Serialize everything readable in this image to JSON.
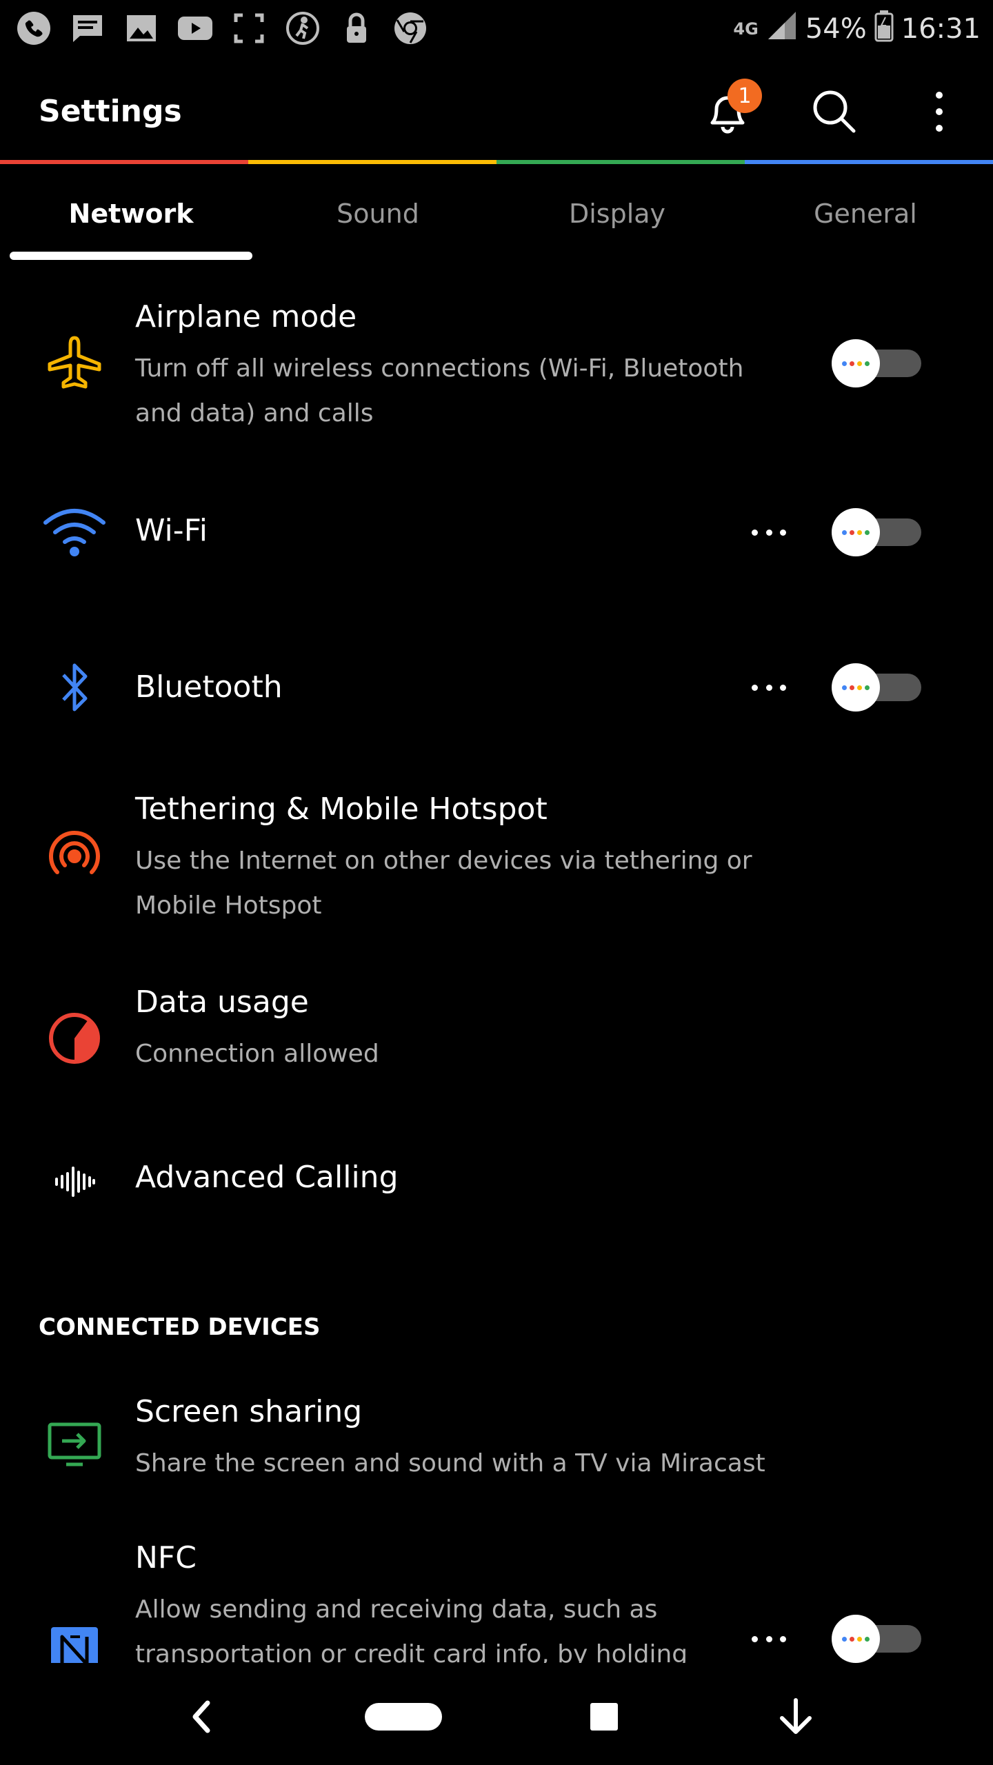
{
  "status_bar": {
    "network": "4G",
    "battery": "54%",
    "time": "16:31",
    "left_icons": [
      "phone-app-icon",
      "message-icon",
      "gallery-icon",
      "youtube-icon",
      "screenshot-icon",
      "fitness-icon",
      "lock-icon",
      "chrome-icon"
    ]
  },
  "app_bar": {
    "title": "Settings",
    "notification_count": "1"
  },
  "tabs": [
    {
      "label": "Network",
      "active": true
    },
    {
      "label": "Sound",
      "active": false
    },
    {
      "label": "Display",
      "active": false
    },
    {
      "label": "General",
      "active": false
    }
  ],
  "rainbow_colors": [
    "#ea4335",
    "#fbbc05",
    "#34a853",
    "#4285f4"
  ],
  "items": {
    "airplane": {
      "title": "Airplane mode",
      "subtitle": "Turn off all wireless connections (Wi-Fi, Bluetooth and data) and calls",
      "toggle_on": false,
      "icon": "airplane-icon",
      "color": "#f5b400"
    },
    "wifi": {
      "title": "Wi-Fi",
      "toggle_on": false,
      "icon": "wifi-icon",
      "color": "#4285f4"
    },
    "bluetooth": {
      "title": "Bluetooth",
      "toggle_on": false,
      "icon": "bluetooth-icon",
      "color": "#4285f4"
    },
    "tethering": {
      "title": "Tethering & Mobile Hotspot",
      "subtitle": "Use the Internet on other devices via tethering or Mobile Hotspot",
      "icon": "hotspot-icon",
      "color": "#f4511e"
    },
    "data_usage": {
      "title": "Data usage",
      "subtitle": "Connection allowed",
      "icon": "data-usage-icon",
      "color": "#ea4335"
    },
    "advanced_calling": {
      "title": "Advanced Calling",
      "icon": "advanced-calling-icon",
      "color": "#ffffff"
    }
  },
  "section_connected": "CONNECTED DEVICES",
  "connected": {
    "screen_sharing": {
      "title": "Screen sharing",
      "subtitle": "Share the screen and sound with a TV via Miracast",
      "icon": "screen-cast-icon",
      "color": "#34a853"
    },
    "nfc": {
      "title": "NFC",
      "subtitle": "Allow sending and receiving data, such as transportation or credit card info, by holding",
      "toggle_on": false,
      "icon": "nfc-icon",
      "color": "#4285f4"
    }
  },
  "nav_bar": [
    "back-icon",
    "home-pill-icon",
    "recents-icon",
    "notification-pull-icon"
  ]
}
